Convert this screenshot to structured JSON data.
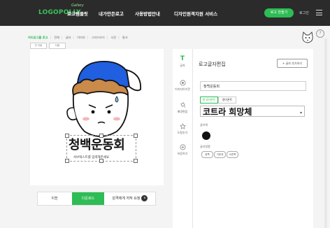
{
  "header": {
    "logo_tag": "Gallery",
    "logo_text": "LOGOPOLLY",
    "nav": [
      "로고템플릿",
      "내가만든로고",
      "사용방법안내",
      "디자인원격지원 서비스"
    ],
    "cta_label": "로고 만들기",
    "user_label": "로그인"
  },
  "breadcrumbs": [
    "아티공그룹 로고",
    "전체",
    "글자",
    "이미지",
    "그리드보기",
    "사진",
    "통사"
  ],
  "mini_buttons": [
    "전 이동",
    "다음"
  ],
  "canvas": {
    "logo_text": "청백운동회",
    "subtitle": "서브텍스트를 입력해주세요"
  },
  "bottom_bar": {
    "buttons": [
      "이전",
      "다운로드",
      "원격에게 저작 요청"
    ],
    "badge": "N"
  },
  "side_tabs": [
    {
      "label": "글자",
      "icon": "text-icon"
    },
    {
      "label": "이미지아이콘",
      "icon": "image-icon"
    },
    {
      "label": "배경편집",
      "icon": "paint-icon"
    },
    {
      "label": "도형추가",
      "icon": "star-icon"
    },
    {
      "label": "저장하기",
      "icon": "save-icon"
    }
  ],
  "panel": {
    "title": "로고글자편집",
    "action_label": "+ 글자 추가하기",
    "text_value": "청백운동회",
    "toggles": [
      "한국어폰트",
      "영어폰트"
    ],
    "font_name": "코트라 희망체",
    "color_label": "글자색",
    "color_value": "#111111",
    "align_label": "글자정렬",
    "align_options": [
      "왼쪽",
      "가운데",
      "오른쪽"
    ]
  },
  "colors": {
    "accent": "#2ebc55",
    "topbar": "#2b2b2b",
    "cap": "#1f5fe0"
  }
}
